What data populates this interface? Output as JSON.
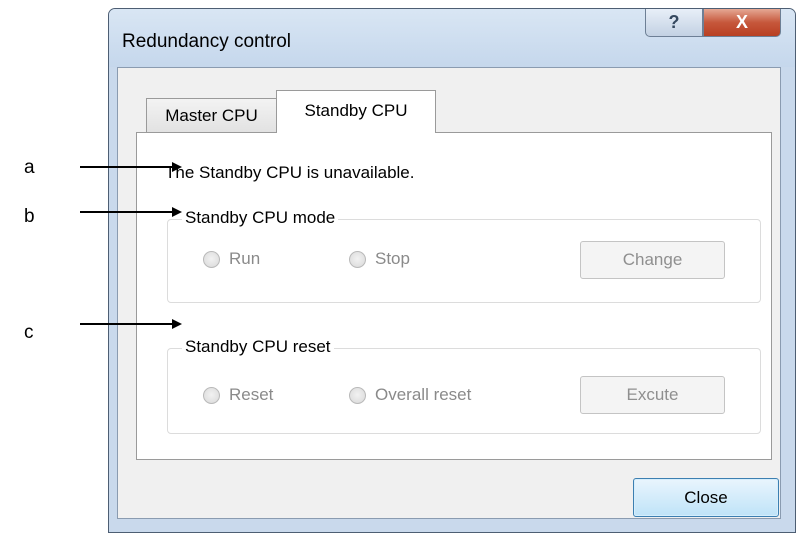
{
  "window": {
    "title": "Redundancy control",
    "help_symbol": "?",
    "close_symbol": "X"
  },
  "tabs": [
    {
      "label": "Master CPU",
      "selected": false
    },
    {
      "label": "Standby CPU",
      "selected": true
    }
  ],
  "status_text": "The Standby CPU is unavailable.",
  "mode_group": {
    "legend": "Standby CPU mode",
    "options": [
      "Run",
      "Stop"
    ],
    "button": "Change"
  },
  "reset_group": {
    "legend": "Standby CPU reset",
    "options": [
      "Reset",
      "Overall reset"
    ],
    "button": "Excute"
  },
  "close_button": "Close",
  "annotations": [
    "a",
    "b",
    "c"
  ]
}
